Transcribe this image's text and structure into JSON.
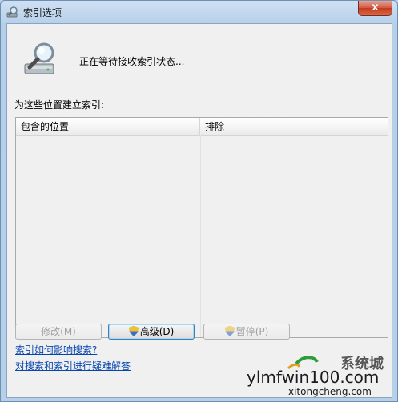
{
  "window": {
    "title": "索引选项",
    "close_label": "x"
  },
  "status": {
    "text": "正在等待接收索引状态..."
  },
  "locations": {
    "label": "为这些位置建立索引:",
    "columns": [
      "包含的位置",
      "排除"
    ]
  },
  "buttons": {
    "modify": "修改(M)",
    "advanced": "高级(D)",
    "pause": "暂停(P)"
  },
  "links": {
    "how_index_affects": "索引如何影响搜索?",
    "troubleshoot": "对搜索和索引进行疑难解答"
  },
  "watermark": {
    "main": "ylmfwin100.com",
    "sub": "xitongcheng.com",
    "cn": "系统城"
  },
  "colors": {
    "link": "#0645ad",
    "window_frame": "#b9d1ea",
    "client_bg": "#f0f0f0"
  }
}
